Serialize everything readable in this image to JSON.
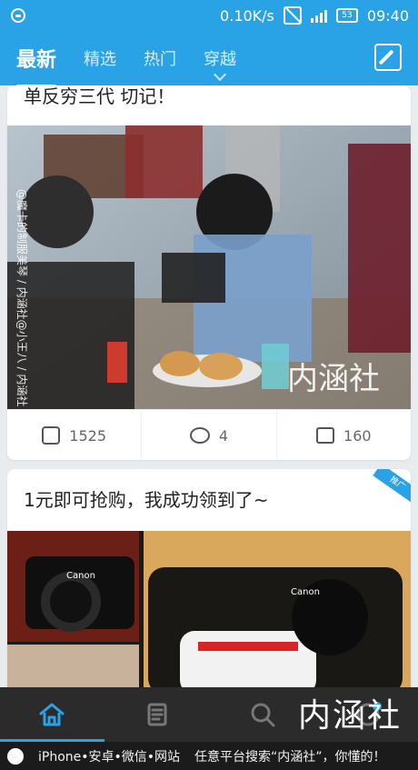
{
  "status": {
    "speed": "0.10K/s",
    "battery": "53",
    "time": "09:40"
  },
  "topnav": {
    "tabs": [
      {
        "label": "最新"
      },
      {
        "label": "精选"
      },
      {
        "label": "热门"
      },
      {
        "label": "穿越"
      }
    ]
  },
  "feed": {
    "cards": [
      {
        "title": "单反穷三代 切记！",
        "watermark": "内涵社",
        "side_caption": "@魔卡的制服美琴 / 内涵社@小王八 / 内涵社",
        "likes": "1525",
        "comments": "4",
        "shares": "160"
      },
      {
        "title": "1元即可抢购，我成功领到了~",
        "ad_badge": "推广",
        "brand_text": "Canon"
      }
    ]
  },
  "bottomnav": {
    "watermark": "内涵社"
  },
  "footer": {
    "left": "iPhone•安卓•微信•网站",
    "right": "任意平台搜索“内涵社”，你懂的！"
  }
}
